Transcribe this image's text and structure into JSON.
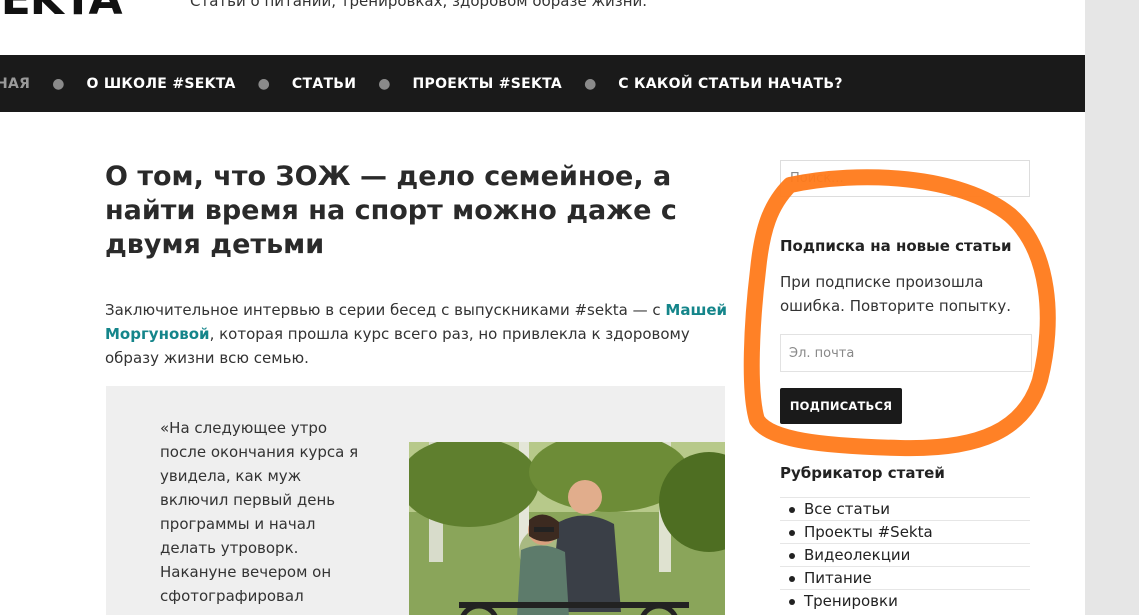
{
  "header": {
    "logo": "SEKTA",
    "tagline": "Статьи о питании, тренировках, здоровом образе жизни."
  },
  "nav": {
    "items": [
      {
        "label": "НАЯ"
      },
      {
        "label": "О ШКОЛЕ #SEKTA"
      },
      {
        "label": "СТАТЬИ"
      },
      {
        "label": "ПРОЕКТЫ #SEKTA"
      },
      {
        "label": "С КАКОЙ СТАТЬИ НАЧАТЬ?"
      }
    ]
  },
  "article": {
    "title": "О том, что ЗОЖ — дело семейное, а найти время на спорт можно даже с двумя детьми",
    "intro_before": "Заключительное интервью в серии бесед с выпускниками #sekta — с ",
    "intro_link": "Машей Моргуновой",
    "intro_after": ", которая прошла курс всего раз, но привлекла к здоровому образу жизни всю семью.",
    "quote": "«На следующее утро после окончания курса я увидела, как муж включил первый день программы и начал делать утроворк. Накануне вечером он сфотографировал"
  },
  "sidebar": {
    "search_placeholder": "Поиск...",
    "subscribe": {
      "title": "Подписка на новые статьи",
      "error": "При подписке произошла ошибка. Повторите попытку.",
      "email_placeholder": "Эл. почта",
      "button": "ПОДПИСАТЬСЯ"
    },
    "categories": {
      "title": "Рубрикатор статей",
      "items": [
        "Все статьи",
        "Проекты #Sekta",
        "Видеолекции",
        "Питание",
        "Тренировки"
      ]
    }
  },
  "colors": {
    "nav_bg": "#1a1a1a",
    "link": "#14858a",
    "annotation": "#ff7a1a"
  }
}
